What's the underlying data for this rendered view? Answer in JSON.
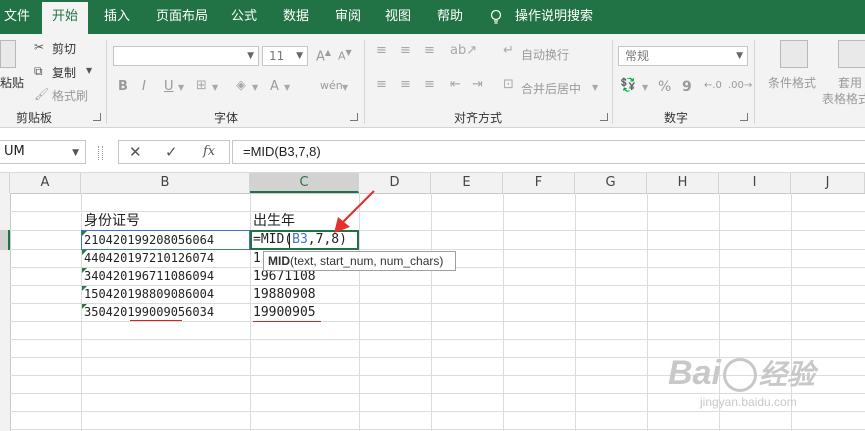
{
  "ribbon": {
    "tabs": [
      "文件",
      "开始",
      "插入",
      "页面布局",
      "公式",
      "数据",
      "审阅",
      "视图",
      "帮助"
    ],
    "active_tab": "开始",
    "tell_me": "操作说明搜索",
    "clipboard": {
      "paste": "粘贴",
      "cut": "剪切",
      "copy": "复制",
      "format_painter": "格式刷",
      "label": "剪贴板"
    },
    "font": {
      "size": "11",
      "bold": "B",
      "italic": "I",
      "underline": "U",
      "label": "字体"
    },
    "alignment": {
      "wrap_text": "自动换行",
      "merge_center": "合并后居中",
      "label": "对齐方式"
    },
    "number": {
      "format": "常规",
      "currency": "$",
      "percent": "%",
      "comma": "9",
      "label": "数字"
    },
    "styles": {
      "conditional_formatting": "条件格式",
      "format_as_table": "套用",
      "format_as_table_2": "表格格式"
    }
  },
  "formula_bar": {
    "name_box": "UM",
    "cancel": "✕",
    "enter": "✓",
    "fx": "fx",
    "formula": "=MID(B3,7,8)"
  },
  "grid": {
    "columns": [
      "A",
      "B",
      "C",
      "D",
      "E",
      "F",
      "G",
      "H",
      "I",
      "J"
    ],
    "selected_column": "C",
    "header_b": "身份证号",
    "header_c": "出生年",
    "ids": [
      "210420199208056064",
      "440420197210126074",
      "340420196711086094",
      "150420198809086004",
      "350420199009056034"
    ],
    "editing_formula": {
      "prefix": "=MID(",
      "ref": "B3",
      "suffix": ",7,8)"
    },
    "results": [
      "1",
      "19671108",
      "19880908",
      "19900905"
    ],
    "tooltip": {
      "fn": "MID",
      "args": "(text, start_num, num_chars)"
    }
  },
  "watermark": {
    "brand": "Bai",
    "brand_suffix": "经验",
    "url": "jingyan.baidu.com"
  },
  "colors": {
    "excel_green": "#217346",
    "annotation_red": "#e8312f",
    "reference_blue": "#4472c4"
  }
}
